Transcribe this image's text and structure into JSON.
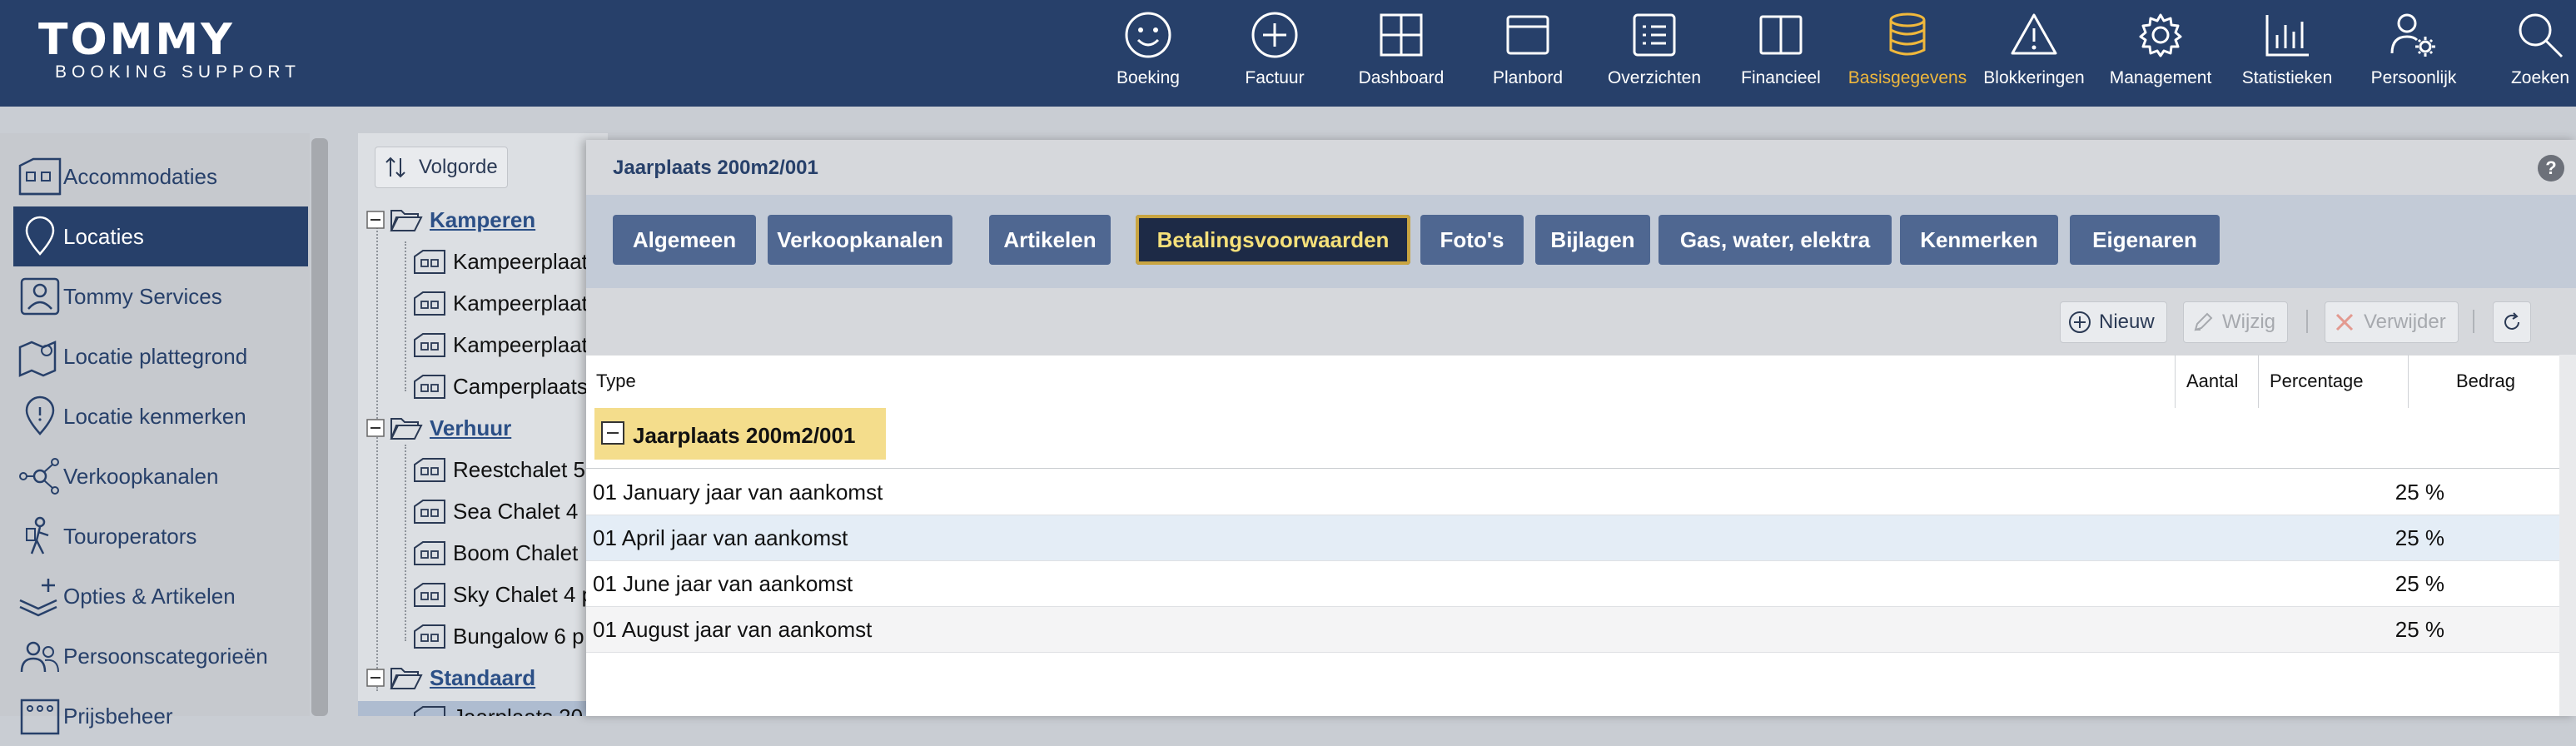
{
  "app": {
    "logo_main": "TOMMY",
    "logo_sub": "BOOKING SUPPORT"
  },
  "nav": [
    {
      "label": "Boeking",
      "icon": "smiley-icon"
    },
    {
      "label": "Factuur",
      "icon": "plus-circle-icon"
    },
    {
      "label": "Dashboard",
      "icon": "grid-icon"
    },
    {
      "label": "Planbord",
      "icon": "window-icon"
    },
    {
      "label": "Overzichten",
      "icon": "list-icon"
    },
    {
      "label": "Financieel",
      "icon": "book-icon"
    },
    {
      "label": "Basisgegevens",
      "icon": "database-icon",
      "active": true
    },
    {
      "label": "Blokkeringen",
      "icon": "warning-icon"
    },
    {
      "label": "Management",
      "icon": "gear-icon"
    },
    {
      "label": "Statistieken",
      "icon": "bar-chart-icon"
    },
    {
      "label": "Persoonlijk",
      "icon": "user-gear-icon"
    },
    {
      "label": "Zoeken",
      "icon": "search-icon"
    }
  ],
  "sidebar": {
    "items": [
      {
        "label": "Accommodaties",
        "icon": "building-icon"
      },
      {
        "label": "Locaties",
        "icon": "location-pin-icon",
        "active": true
      },
      {
        "label": "Tommy Services",
        "icon": "person-card-icon"
      },
      {
        "label": "Locatie plattegrond",
        "icon": "map-pin-icon"
      },
      {
        "label": "Locatie kenmerken",
        "icon": "pin-info-icon"
      },
      {
        "label": "Verkoopkanalen",
        "icon": "network-icon"
      },
      {
        "label": "Touroperators",
        "icon": "traveler-icon"
      },
      {
        "label": "Opties & Artikelen",
        "icon": "layers-plus-icon"
      },
      {
        "label": "Persoonscategorieën",
        "icon": "people-icon"
      },
      {
        "label": "Prijsbeheer",
        "icon": "price-icon"
      }
    ]
  },
  "tree": {
    "sort_label": "Volgorde",
    "groups": [
      {
        "label": "Kamperen",
        "items": [
          "Kampeerplaat",
          "Kampeerplaat",
          "Kampeerplaat",
          "Camperplaats"
        ]
      },
      {
        "label": "Verhuur",
        "items": [
          "Reestchalet 5",
          "Sea Chalet 4",
          "Boom Chalet",
          "Sky Chalet 4 p",
          "Bungalow 6 p"
        ]
      },
      {
        "label": "Standaard",
        "items": [
          "Jaarplaats 20"
        ]
      }
    ]
  },
  "dialog": {
    "title": "Jaarplaats 200m2/001",
    "help": "?",
    "tabs": [
      {
        "label": "Algemeen"
      },
      {
        "label": "Verkoopkanalen"
      },
      {
        "label": "Artikelen"
      },
      {
        "label": "Betalingsvoorwaarden",
        "active": true
      },
      {
        "label": "Foto's"
      },
      {
        "label": "Bijlagen"
      },
      {
        "label": "Gas, water, elektra"
      },
      {
        "label": "Kenmerken"
      },
      {
        "label": "Eigenaren"
      }
    ],
    "toolbar": {
      "new_label": "Nieuw",
      "edit_label": "Wijzig",
      "delete_label": "Verwijder"
    },
    "grid": {
      "columns": [
        "Type",
        "Aantal",
        "Percentage",
        "Bedrag"
      ],
      "group_label": "Jaarplaats 200m2/001",
      "rows": [
        {
          "type": "01 January jaar van aankomst",
          "percentage": "25 %"
        },
        {
          "type": "01 April jaar van aankomst",
          "percentage": "25 %"
        },
        {
          "type": "01 June jaar van aankomst",
          "percentage": "25 %"
        },
        {
          "type": "01 August jaar van aankomst",
          "percentage": "25 %"
        }
      ]
    }
  },
  "colors": {
    "header_bg": "#27406a",
    "active_nav": "#f0b83c",
    "tab_bg": "#4f6791",
    "tab_active_bg": "#1d2a46",
    "group_highlight": "#f4dd8c"
  }
}
